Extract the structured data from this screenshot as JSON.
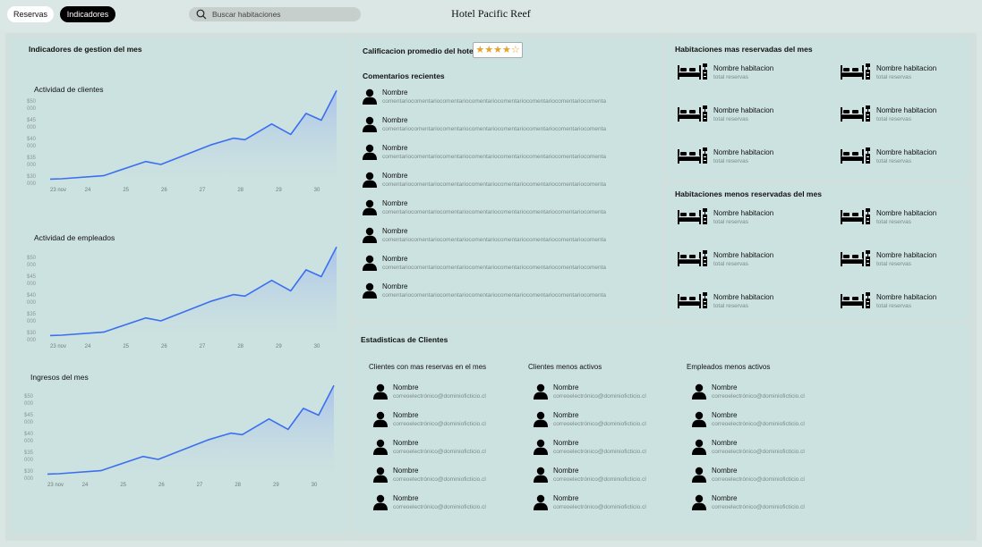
{
  "nav": {
    "tab_reservas": "Reservas",
    "tab_indicadores": "Indicadores"
  },
  "search": {
    "placeholder": "Buscar habitaciones"
  },
  "app_title": "Hotel Pacific Reef",
  "left_panel": {
    "title": "Indicadores de gestion del mes"
  },
  "charts": [
    {
      "title": "Actividad de clientes"
    },
    {
      "title": "Actividad de empleados"
    },
    {
      "title": "Ingresos del mes"
    }
  ],
  "chart_data": [
    {
      "type": "area",
      "title": "Actividad de clientes",
      "xlabel": "",
      "ylabel": "",
      "y_tick_labels": [
        "$50 000",
        "$45 000",
        "$40 000",
        "$35 000",
        "$30 000"
      ],
      "x_tick_labels": [
        "23 nov",
        "24",
        "25",
        "26",
        "27",
        "28",
        "29",
        "30"
      ],
      "ylim": [
        30000,
        50000
      ],
      "grid": false,
      "x": [
        23,
        23.3,
        24.4,
        25.5,
        25.9,
        27.2,
        27.8,
        28.1,
        28.8,
        29.3,
        29.7,
        30.1,
        30.5
      ],
      "y": [
        29900,
        30000,
        30800,
        34600,
        33800,
        39000,
        40800,
        40400,
        44600,
        41800,
        47400,
        45600,
        53500
      ]
    },
    {
      "type": "area",
      "title": "Actividad de empleados",
      "xlabel": "",
      "ylabel": "",
      "y_tick_labels": [
        "$50 000",
        "$45 000",
        "$40 000",
        "$35 000",
        "$30 000"
      ],
      "x_tick_labels": [
        "23 nov",
        "24",
        "25",
        "26",
        "27",
        "28",
        "29",
        "30"
      ],
      "ylim": [
        30000,
        50000
      ],
      "grid": false,
      "x": [
        23,
        23.3,
        24.4,
        25.5,
        25.9,
        27.2,
        27.8,
        28.1,
        28.8,
        29.3,
        29.7,
        30.1,
        30.5
      ],
      "y": [
        29900,
        30000,
        30800,
        34600,
        33800,
        39000,
        40800,
        40400,
        44600,
        41800,
        47400,
        45600,
        53500
      ]
    },
    {
      "type": "area",
      "title": "Ingresos del mes",
      "xlabel": "",
      "ylabel": "",
      "y_tick_labels": [
        "$50 000",
        "$45 000",
        "$40 000",
        "$35 000",
        "$30 000"
      ],
      "x_tick_labels": [
        "23 nov",
        "24",
        "25",
        "26",
        "27",
        "28",
        "29",
        "30"
      ],
      "ylim": [
        30000,
        50000
      ],
      "grid": false,
      "x": [
        23,
        23.3,
        24.4,
        25.5,
        25.9,
        27.2,
        27.8,
        28.1,
        28.8,
        29.3,
        29.7,
        30.1,
        30.5
      ],
      "y": [
        29900,
        30000,
        30800,
        34600,
        33800,
        39000,
        40800,
        40400,
        44600,
        41800,
        47400,
        45600,
        53500
      ]
    }
  ],
  "rating": {
    "label": "Calificacion promedio del hotel",
    "value": 4,
    "max": 5,
    "star_color": "#e1a32b"
  },
  "comments": {
    "title": "Comentarios recientes",
    "items": [
      {
        "name": "Nombre",
        "text": "comentariocomentariocomentariocomentariocomentariocomentariocomentariocomenta"
      },
      {
        "name": "Nombre",
        "text": "comentariocomentariocomentariocomentariocomentariocomentariocomentariocomenta"
      },
      {
        "name": "Nombre",
        "text": "comentariocomentariocomentariocomentariocomentariocomentariocomentariocomenta"
      },
      {
        "name": "Nombre",
        "text": "comentariocomentariocomentariocomentariocomentariocomentariocomentariocomenta"
      },
      {
        "name": "Nombre",
        "text": "comentariocomentariocomentariocomentariocomentariocomentariocomentariocomenta"
      },
      {
        "name": "Nombre",
        "text": "comentariocomentariocomentariocomentariocomentariocomentariocomentariocomenta"
      },
      {
        "name": "Nombre",
        "text": "comentariocomentariocomentariocomentariocomentariocomentariocomentariocomenta"
      },
      {
        "name": "Nombre",
        "text": "comentariocomentariocomentariocomentariocomentariocomentariocomentariocomenta"
      }
    ]
  },
  "rooms_most": {
    "title": "Habitaciones mas reservadas del mes",
    "items": [
      {
        "name": "Nombre habitacion",
        "sub": "total reservas",
        "icon": "bed-icon"
      },
      {
        "name": "Nombre habitacion",
        "sub": "total reservas",
        "icon": "bed-icon"
      },
      {
        "name": "Nombre habitacion",
        "sub": "total reservas",
        "icon": "bed-icon"
      },
      {
        "name": "Nombre habitacion",
        "sub": "total reservas",
        "icon": "bed-icon"
      },
      {
        "name": "Nombre habitacion",
        "sub": "total reservas",
        "icon": "bed-icon"
      },
      {
        "name": "Nombre habitacion",
        "sub": "total reservas",
        "icon": "bed-icon"
      }
    ]
  },
  "rooms_least": {
    "title": "Habitaciones menos reservadas del mes",
    "items": [
      {
        "name": "Nombre habitacion",
        "sub": "total reservas",
        "icon": "bed-icon"
      },
      {
        "name": "Nombre habitacion",
        "sub": "total reservas",
        "icon": "bed-icon"
      },
      {
        "name": "Nombre habitacion",
        "sub": "total reservas",
        "icon": "bed-icon"
      },
      {
        "name": "Nombre habitacion",
        "sub": "total reservas",
        "icon": "bed-icon"
      },
      {
        "name": "Nombre habitacion",
        "sub": "total reservas",
        "icon": "bed-icon"
      },
      {
        "name": "Nombre habitacion",
        "sub": "total reservas",
        "icon": "bed-icon"
      }
    ]
  },
  "stats": {
    "title": "Estadisticas de Clientes",
    "columns": [
      {
        "title": "Clientes con mas reservas en el mes",
        "items": [
          {
            "name": "Nombre",
            "email": "correoelectrónico@dominioficticio.cl"
          },
          {
            "name": "Nombre",
            "email": "correoelectrónico@dominioficticio.cl"
          },
          {
            "name": "Nombre",
            "email": "correoelectrónico@dominioficticio.cl"
          },
          {
            "name": "Nombre",
            "email": "correoelectrónico@dominioficticio.cl"
          },
          {
            "name": "Nombre",
            "email": "correoelectrónico@dominioficticio.cl"
          }
        ]
      },
      {
        "title": "Clientes menos activos",
        "items": [
          {
            "name": "Nombre",
            "email": "correoelectrónico@dominioficticio.cl"
          },
          {
            "name": "Nombre",
            "email": "correoelectrónico@dominioficticio.cl"
          },
          {
            "name": "Nombre",
            "email": "correoelectrónico@dominioficticio.cl"
          },
          {
            "name": "Nombre",
            "email": "correoelectrónico@dominioficticio.cl"
          },
          {
            "name": "Nombre",
            "email": "correoelectrónico@dominioficticio.cl"
          }
        ]
      },
      {
        "title": "Empleados menos activos",
        "items": [
          {
            "name": "Nombre",
            "email": "correoelectrónico@dominioficticio.cl"
          },
          {
            "name": "Nombre",
            "email": "correoelectrónico@dominioficticio.cl"
          },
          {
            "name": "Nombre",
            "email": "correoelectrónico@dominioficticio.cl"
          },
          {
            "name": "Nombre",
            "email": "correoelectrónico@dominioficticio.cl"
          },
          {
            "name": "Nombre",
            "email": "correoelectrónico@dominioficticio.cl"
          }
        ]
      }
    ]
  },
  "colors": {
    "line": "#3b6ff0",
    "panel": "#cce2e0",
    "accent_black": "#000000"
  }
}
